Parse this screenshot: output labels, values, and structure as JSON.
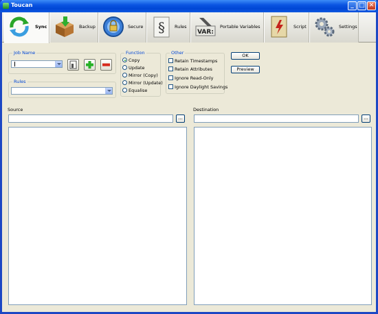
{
  "window": {
    "title": "Toucan"
  },
  "titlebar": {
    "min_glyph": "_",
    "max_glyph": "□",
    "close_glyph": "✕"
  },
  "tabs": [
    {
      "label": "Sync",
      "icon": "sync-icon",
      "active": true
    },
    {
      "label": "Backup",
      "icon": "backup-box-icon",
      "active": false
    },
    {
      "label": "Secure",
      "icon": "secure-lock-icon",
      "active": false
    },
    {
      "label": "Rules",
      "icon": "rules-section-icon",
      "active": false
    },
    {
      "label": "Portable Variables",
      "icon": "variables-icon",
      "active": false
    },
    {
      "label": "Script",
      "icon": "script-icon",
      "active": false
    },
    {
      "label": "Settings",
      "icon": "settings-gears-icon",
      "active": false
    }
  ],
  "job": {
    "group_title": "Job Name",
    "value": "",
    "save_icon": "save-icon",
    "add_icon": "add-icon",
    "remove_icon": "remove-icon"
  },
  "rules": {
    "group_title": "Rules",
    "value": ""
  },
  "function": {
    "group_title": "Function",
    "options": [
      "Copy",
      "Update",
      "Mirror (Copy)",
      "Mirror (Update)",
      "Equalise"
    ],
    "selected": "Copy"
  },
  "other": {
    "group_title": "Other",
    "options": [
      "Retain Timestamps",
      "Retain Attributes",
      "Ignore Read-Only",
      "Ignore Daylight Savings"
    ]
  },
  "buttons": {
    "ok": "OK",
    "preview": "Preview"
  },
  "source": {
    "label": "Source",
    "value": "",
    "browse": "..."
  },
  "destination": {
    "label": "Destination",
    "value": "",
    "browse": "..."
  }
}
